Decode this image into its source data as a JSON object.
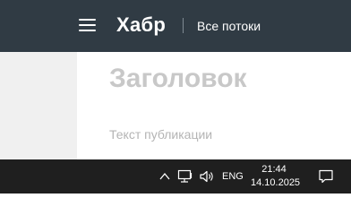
{
  "header": {
    "logo": "Хабр",
    "flows_link": "Все потоки"
  },
  "post": {
    "title": "Заголовок",
    "text": "Текст публикации"
  },
  "taskbar": {
    "language": "ENG",
    "time": "21:44",
    "date": "14.10.2025",
    "icons": [
      "chevron-up-icon",
      "network-icon",
      "volume-icon",
      "notification-icon"
    ]
  },
  "colors": {
    "header_bg": "#303b44",
    "taskbar_bg": "#1f1f1f",
    "placeholder_title": "#c8c8c8",
    "placeholder_text": "#b4b4b4"
  }
}
